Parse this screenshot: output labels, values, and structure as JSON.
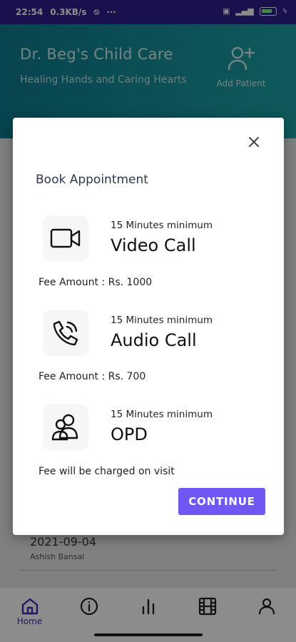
{
  "status_bar": {
    "time": "22:54",
    "speed": "0.3KB/s",
    "dots": "···"
  },
  "header": {
    "clinic_name": "Dr. Beg's Child Care",
    "tagline": "Healing Hands and Caring Hearts",
    "add_patient_label": "Add Patient"
  },
  "record": {
    "date": "2021-09-04",
    "name": "Ashish Bansal"
  },
  "dialog": {
    "title": "Book Appointment",
    "options": [
      {
        "subtitle": "15 Minutes minimum",
        "title": "Video Call",
        "fee": "Fee Amount : Rs. 1000",
        "icon": "video-camera-icon"
      },
      {
        "subtitle": "15 Minutes minimum",
        "title": "Audio Call",
        "fee": "Fee Amount : Rs. 700",
        "icon": "phone-call-icon"
      },
      {
        "subtitle": "15 Minutes minimum",
        "title": "OPD",
        "fee": "Fee will be charged on visit",
        "icon": "people-icon"
      }
    ],
    "continue_label": "CONTINUE"
  },
  "nav": {
    "home_label": "Home",
    "items": [
      "home-icon",
      "info-icon",
      "stats-icon",
      "film-icon",
      "profile-icon"
    ]
  },
  "colors": {
    "accent": "#6e57f2",
    "status_bar": "#2e1f8e",
    "header": "#1ca3a4",
    "nav_active": "#3d2db5"
  }
}
